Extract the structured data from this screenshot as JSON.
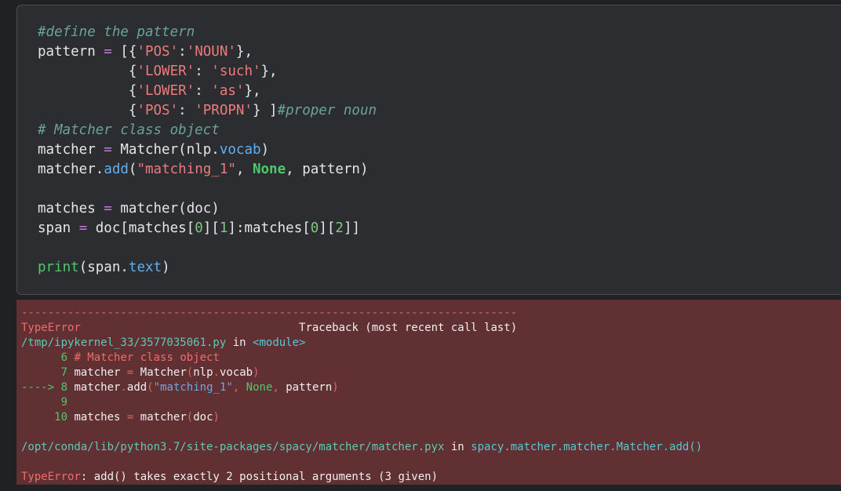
{
  "code_cell": {
    "comment_define": "#define the pattern",
    "pattern_var": "pattern",
    "assign": " = ",
    "open_list": "[{",
    "close_dict": "},",
    "open_dict": "{",
    "colon_nospace": ":",
    "colon_space": ": ",
    "key_pos": "'POS'",
    "val_noun": "'NOUN'",
    "key_lower": "'LOWER'",
    "val_such": "'such'",
    "val_as": "'as'",
    "val_propn": "'PROPN'",
    "close_last": "} ]",
    "comment_propn": "#proper noun",
    "comment_matcher": "# Matcher class object",
    "matcher_var": "matcher",
    "matcher_class": "Matcher",
    "nlp": "nlp",
    "vocab": "vocab",
    "add": "add",
    "str_matching": "\"matching_1\"",
    "none_kw": "None",
    "matches_var": "matches",
    "doc": "doc",
    "span_var": "span",
    "idx0": "0",
    "idx1": "1",
    "idx2": "2",
    "print": "print",
    "text_attr": "text"
  },
  "output": {
    "dashes": "---------------------------------------------------------------------------",
    "error_type": "TypeError",
    "traceback_header": "Traceback (most recent call last)",
    "kernel_path": "/tmp/ipykernel_33/3577035061.py",
    "in_word": "in",
    "module": "<module>",
    "ln6": "6",
    "ln7": "7",
    "ln8": "8",
    "ln9": "9",
    "ln10": "10",
    "comment_matcher": "# Matcher class object",
    "arrow": "---->",
    "site_path": "/opt/conda/lib/python3.7/site-packages/spacy/matcher/matcher.pyx",
    "func_ref": "spacy.matcher.matcher.Matcher.add()",
    "error_message": ": add() takes exactly 2 positional arguments (3 given)"
  },
  "colors": {
    "background": "#202124",
    "code_cell_bg": "#2b2d30",
    "error_bg": "#613032",
    "comment": "#6aa39a",
    "string": "#ee7b7b",
    "keyword": "#4ec96a",
    "attribute": "#61afef",
    "operator": "#c678dd"
  }
}
